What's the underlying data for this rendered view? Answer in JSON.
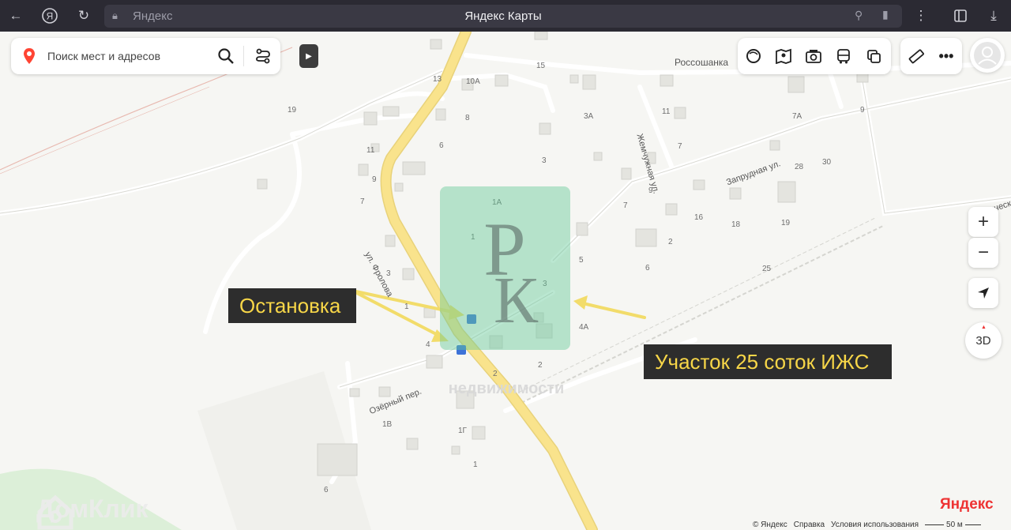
{
  "browser": {
    "address_domain": "Яндекс",
    "page_title": "Яндекс Карты"
  },
  "search": {
    "placeholder": "Поиск мест и адресов"
  },
  "map": {
    "streets": {
      "frolova": "ул. Фролова",
      "zhemchuzhnaya": "Жемчужная ул.",
      "zaprudnaya": "Запрудная ул.",
      "tavricheskaya": "Таврическ",
      "ozerny": "Озёрный пер.",
      "rossoshanka": "Россошанка"
    },
    "house_numbers": [
      "15",
      "13",
      "10А",
      "8",
      "3А",
      "11",
      "7А",
      "9",
      "19",
      "6",
      "11",
      "3",
      "7",
      "28",
      "30",
      "9",
      "7",
      "1А",
      "9",
      "7",
      "16",
      "18",
      "19",
      "2",
      "1",
      "5",
      "6",
      "25",
      "3",
      "3",
      "1",
      "4",
      "4А",
      "2",
      "2",
      "1В",
      "1Г",
      "1",
      "6"
    ]
  },
  "callouts": {
    "stop": "Остановка",
    "plot": "Участок 25 соток ИЖС"
  },
  "watermark": {
    "domclick": "ДомКлик",
    "agency": "недвижимости"
  },
  "controls": {
    "zoom_in": "+",
    "zoom_out": "−",
    "view_3d": "3D"
  },
  "footer": {
    "copyright": "© Яндекс",
    "help": "Справка",
    "terms": "Условия использования",
    "scale": "50 м",
    "brand": "Яндекс"
  },
  "colors": {
    "callout_text": "#f7d648",
    "callout_bg": "#2d2d2d",
    "road_main": "#f9e38c",
    "logo_tint": "#66c998",
    "arrow": "#f2dc6a"
  }
}
